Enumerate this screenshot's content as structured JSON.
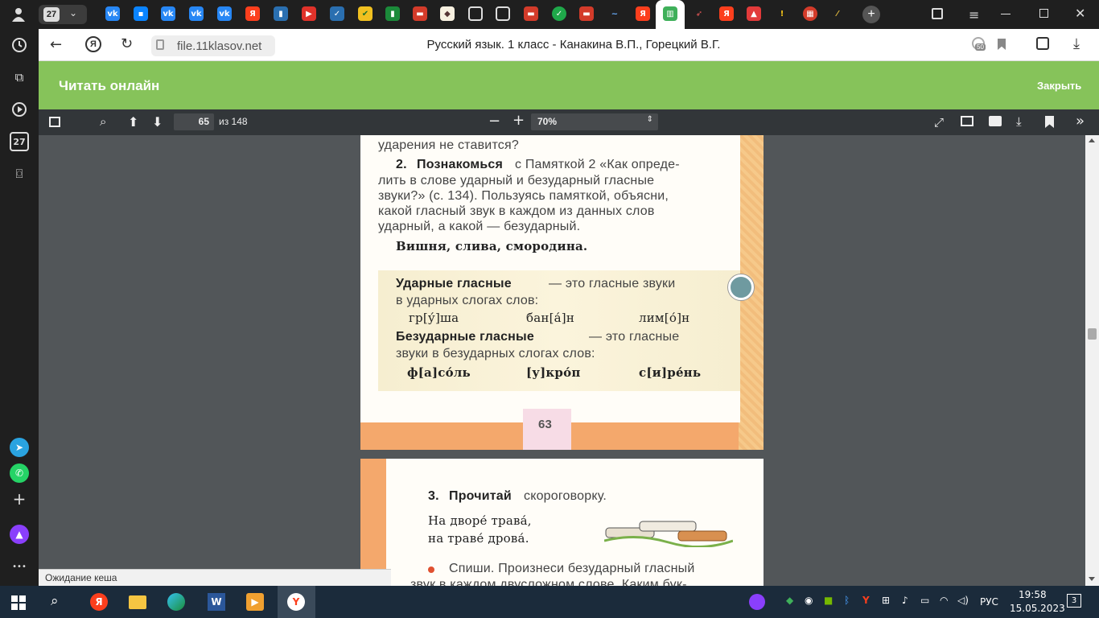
{
  "tabbar": {
    "tab_count": "27",
    "new_tab": "+"
  },
  "sidebar": {
    "badge": "27",
    "more": "•••"
  },
  "address": {
    "url": "file.11klasov.net",
    "title": "Русский язык. 1 класс - Канакина В.П., Горецкий В.Г.",
    "badge": "50"
  },
  "reader": {
    "title": "Читать онлайн",
    "close": "Закрыть"
  },
  "pdf": {
    "page": "65",
    "of": "из 148",
    "zoom": "70%"
  },
  "page63": {
    "top_text": "ударения не ставится?",
    "task2_num": "2.",
    "task2_bold": "Познакомься",
    "task2_lines": [
      "с Памяткой 2 «Как опреде-",
      "лить в слове ударный и безударный гласные",
      "звуки?» (с. 134). Пользуясь памяткой, объясни,",
      "какой гласный звук в каждом из данных слов",
      "ударный, а какой — безударный."
    ],
    "words": "Вишня, слива, смородина.",
    "stressed_bold": "Ударные гласные",
    "stressed_text": "— это гласные звуки",
    "stressed_text2": "в ударных слогах слов:",
    "stressed_ex": [
      "гр[у́]ша",
      "бан[а́]н",
      "лим[о́]н"
    ],
    "unstressed_bold": "Безударные гласные",
    "unstressed_text": "— это гласные",
    "unstressed_text2": "звуки в безударных слогах слов:",
    "unstressed_ex": [
      "ф[а]со́ль",
      "[у]кро́п",
      "с[и]ре́нь"
    ],
    "page_no": "63"
  },
  "page64": {
    "task3_num": "3.",
    "task3_bold": "Прочитай",
    "task3_text": "скороговорку.",
    "verse1": "На дворе́ трава́,",
    "verse2": "на траве́ дрова́.",
    "copy_line": "Спиши. Произнеси безударный гласный",
    "copy_line2": "звук в каждом двусложном слове. Каким бук-"
  },
  "status": "Ожидание кеша",
  "taskbar": {
    "lang": "РУС",
    "time": "19:58",
    "date": "15.05.2023",
    "notif": "3"
  }
}
